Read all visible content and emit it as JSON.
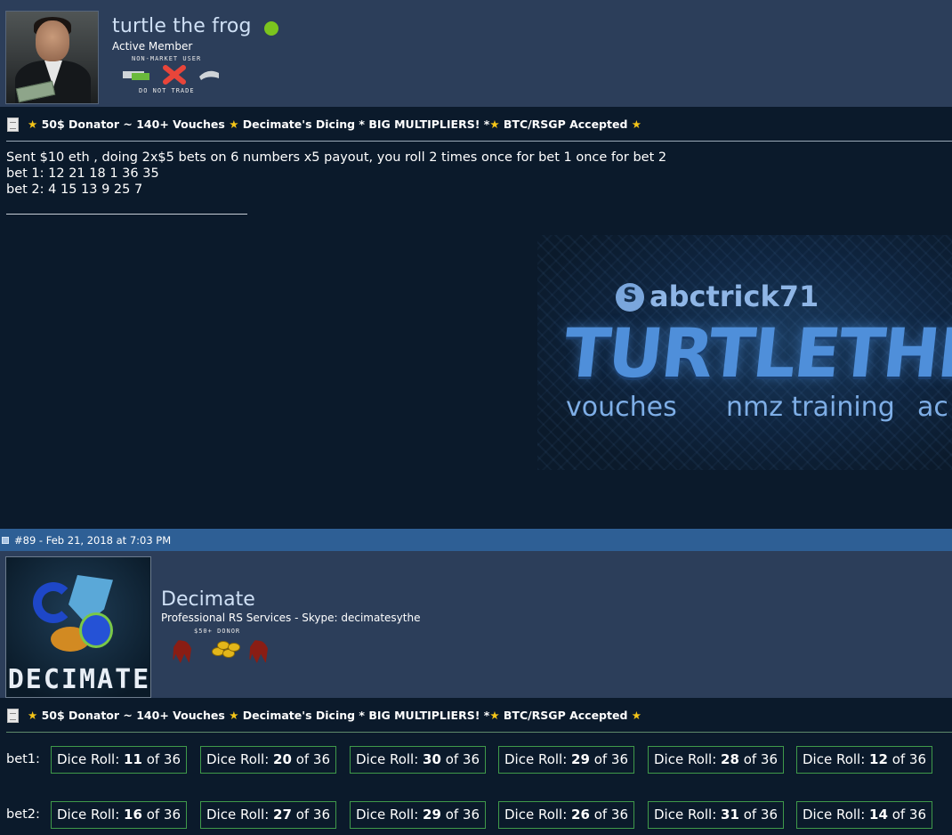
{
  "post1": {
    "username": "turtle the frog",
    "user_title": "Active Member",
    "badge_top": "NON-MARKET USER",
    "badge_bottom": "DO NOT TRADE",
    "thread_title": {
      "segments": [
        "50$ Donator ~ 140+ Vouches",
        "Decimate's Dicing * BIG MULTIPLIERS! *",
        "BTC/RSGP Accepted"
      ]
    },
    "message_lines": [
      "Sent $10 eth , doing 2x$5 bets on 6 numbers x5 payout, you roll 2 times once for bet 1 once for bet 2",
      "bet 1: 12 21 18 1 36 35",
      "bet 2: 4 15 13 9 25 7"
    ],
    "signature": {
      "skype": "abctrick71",
      "title": "TURTLETHEF",
      "tags": [
        "vouches",
        "nmz training",
        "ac"
      ]
    }
  },
  "post2": {
    "post_info": "#89 - Feb 21, 2018 at 7:03 PM",
    "username": "Decimate",
    "user_title": "Professional RS Services - Skype: decimatesythe",
    "badge_top": "$50+ DONOR",
    "avatar_text": "DECIMATE",
    "thread_title": {
      "segments": [
        "50$ Donator ~ 140+ Vouches",
        "Decimate's Dicing * BIG MULTIPLIERS! *",
        "BTC/RSGP Accepted"
      ]
    },
    "bets": [
      {
        "label": "bet1:",
        "rolls": [
          {
            "prefix": "Dice Roll: ",
            "value": "11",
            "suffix": " of 36"
          },
          {
            "prefix": "Dice Roll: ",
            "value": "20",
            "suffix": " of 36"
          },
          {
            "prefix": "Dice Roll: ",
            "value": "30",
            "suffix": " of 36"
          },
          {
            "prefix": "Dice Roll: ",
            "value": "29",
            "suffix": " of 36"
          },
          {
            "prefix": "Dice Roll: ",
            "value": "28",
            "suffix": " of 36"
          },
          {
            "prefix": "Dice Roll: ",
            "value": "12",
            "suffix": " of 36"
          }
        ]
      },
      {
        "label": "bet2:",
        "rolls": [
          {
            "prefix": "Dice Roll: ",
            "value": "16",
            "suffix": " of 36"
          },
          {
            "prefix": "Dice Roll: ",
            "value": "27",
            "suffix": " of 36"
          },
          {
            "prefix": "Dice Roll: ",
            "value": "29",
            "suffix": " of 36"
          },
          {
            "prefix": "Dice Roll: ",
            "value": "26",
            "suffix": " of 36"
          },
          {
            "prefix": "Dice Roll: ",
            "value": "31",
            "suffix": " of 36"
          },
          {
            "prefix": "Dice Roll: ",
            "value": "14",
            "suffix": " of 36"
          }
        ]
      }
    ]
  },
  "colors": {
    "page_bg": "#0b1a2b",
    "userbar_bg": "#2c3e5a",
    "postbar_bg": "#2e5f95",
    "online": "#7bc41e",
    "star": "#f5c518",
    "dice_border": "#3f9a4a"
  }
}
